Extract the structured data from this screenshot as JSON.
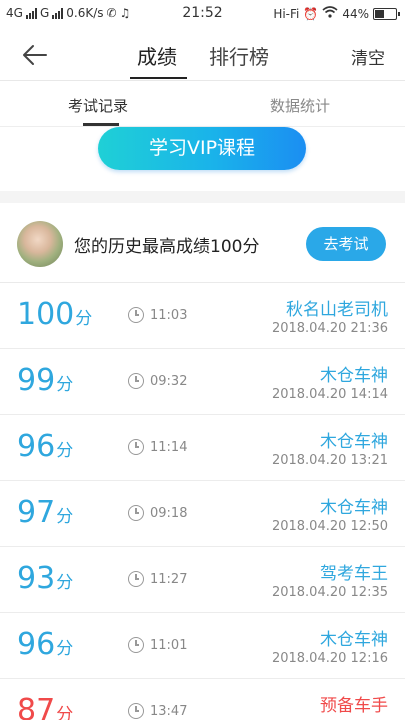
{
  "status_bar": {
    "network": "4G",
    "carrier2": "G",
    "speed": "0.6K/s",
    "time": "21:52",
    "wifi_label": "Hi-Fi",
    "battery": "44%"
  },
  "header": {
    "back_icon": "back-arrow-icon",
    "tabs": [
      {
        "label": "成绩"
      },
      {
        "label": "排行榜"
      }
    ],
    "clear_label": "清空"
  },
  "subtabs": [
    {
      "label": "考试记录"
    },
    {
      "label": "数据统计"
    }
  ],
  "vip": {
    "label": "学习VIP课程"
  },
  "best": {
    "text": "您的历史最高成绩100分",
    "button": "去考试"
  },
  "records": [
    {
      "score": "100",
      "unit": "分",
      "time": "11:03",
      "title": "秋名山老司机",
      "date": "2018.04.20  21:36",
      "color": "#2fa7de"
    },
    {
      "score": "99",
      "unit": "分",
      "time": "09:32",
      "title": "木仓车神",
      "date": "2018.04.20  14:14",
      "color": "#2fa7de"
    },
    {
      "score": "96",
      "unit": "分",
      "time": "11:14",
      "title": "木仓车神",
      "date": "2018.04.20  13:21",
      "color": "#2fa7de"
    },
    {
      "score": "97",
      "unit": "分",
      "time": "09:18",
      "title": "木仓车神",
      "date": "2018.04.20  12:50",
      "color": "#2fa7de"
    },
    {
      "score": "93",
      "unit": "分",
      "time": "11:27",
      "title": "驾考车王",
      "date": "2018.04.20  12:35",
      "color": "#2fa7de"
    },
    {
      "score": "96",
      "unit": "分",
      "time": "11:01",
      "title": "木仓车神",
      "date": "2018.04.20  12:16",
      "color": "#2fa7de"
    },
    {
      "score": "87",
      "unit": "分",
      "time": "13:47",
      "title": "预备车手",
      "date": "",
      "color": "#f04a4a"
    }
  ]
}
